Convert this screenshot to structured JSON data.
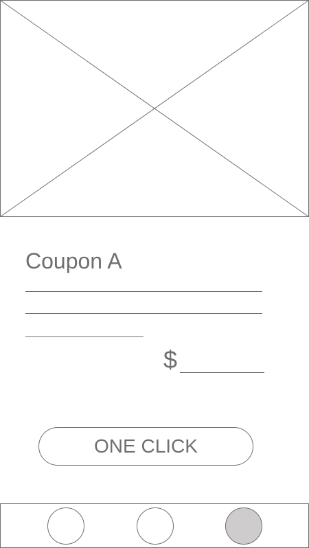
{
  "hero_image": {
    "icon": "image-placeholder-icon"
  },
  "coupon": {
    "title": "Coupon A",
    "price_symbol": "$"
  },
  "action": {
    "button_label": "ONE CLICK"
  },
  "bottom_nav": {
    "items": [
      {
        "icon": "nav-dot-1",
        "active": false
      },
      {
        "icon": "nav-dot-2",
        "active": false
      },
      {
        "icon": "nav-dot-3",
        "active": true
      }
    ]
  },
  "colors": {
    "stroke": "#6f6f6f",
    "active_dot": "#cfcccd",
    "background": "#ffffff"
  }
}
